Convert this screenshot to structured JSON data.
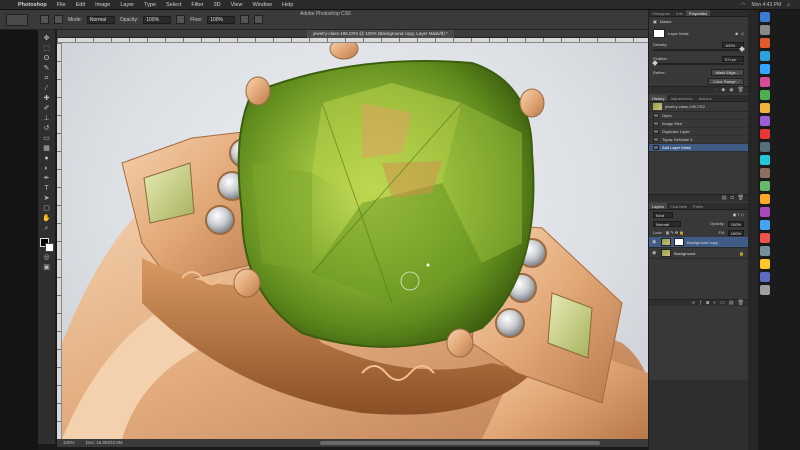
{
  "menubar": {
    "app_name": "Photoshop",
    "items": [
      "File",
      "Edit",
      "Image",
      "Layer",
      "Type",
      "Select",
      "Filter",
      "3D",
      "View",
      "Window",
      "Help"
    ],
    "right": [
      "Mon 4:43 PM"
    ]
  },
  "options": {
    "title": "Adobe Photoshop CS6",
    "fields": [
      {
        "label": "Mode:",
        "value": "Normal"
      },
      {
        "label": "Opacity:",
        "value": "100%"
      },
      {
        "label": "Flow:",
        "value": "100%"
      }
    ]
  },
  "document": {
    "tab_title": "jewelry-class-195.CR2 @ 100% (Background copy, Layer Mask/8) *",
    "status_zoom": "100%",
    "status_doc": "Doc: 16.8M/33.6M"
  },
  "panels": {
    "top_tabs": [
      "Histogram",
      "Info",
      "Properties"
    ],
    "masks_title": "Masks",
    "layer_mask_label": "Layer Mask",
    "density_label": "Density:",
    "density_value": "100%",
    "feather_label": "Feather:",
    "feather_value": "0.0 px",
    "refine_label": "Refine:",
    "mask_edge_button": "Mask Edge...",
    "color_range_button": "Color Range...",
    "history_tabs": [
      "History",
      "Adjustments",
      "Actions"
    ],
    "history_snapshot": "jewelry-class-195.CR2",
    "history_items": [
      "Open",
      "Image Size",
      "Duplicate Layer",
      "Topaz DeNoise 5",
      "Add Layer Mask"
    ],
    "layers_tabs": [
      "Layers",
      "Channels",
      "Paths"
    ],
    "blend_mode": "Normal",
    "opacity_label": "Opacity:",
    "opacity_value": "100%",
    "fill_label": "Fill:",
    "fill_value": "100%",
    "lock_label": "Lock:",
    "layers": [
      "Background copy",
      "Background"
    ]
  },
  "colors": {
    "accent": "#3e5c86",
    "peridot": "#8bb032",
    "gold": "#e4b187",
    "canvas_bg": "#dcdfe4"
  }
}
